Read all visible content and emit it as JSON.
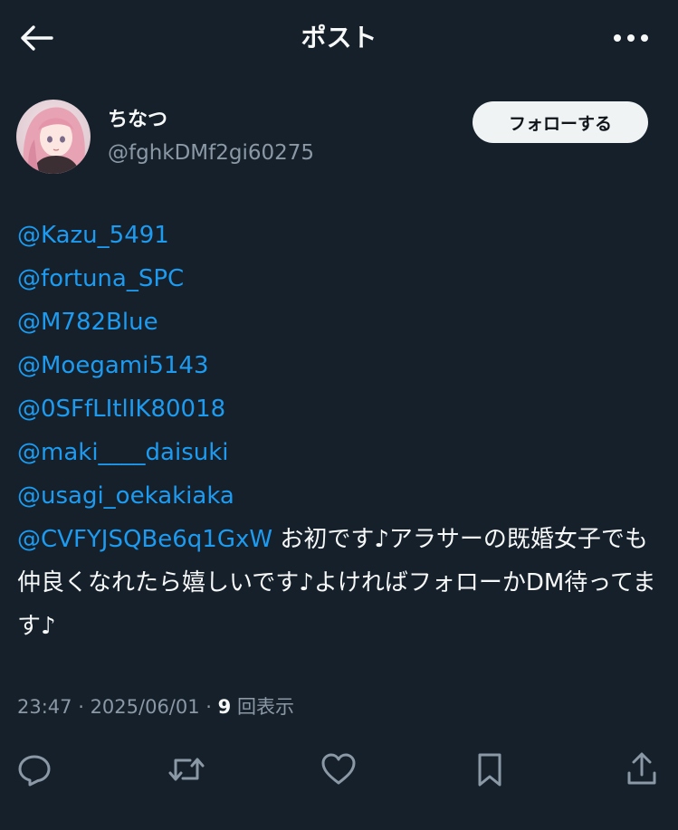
{
  "header": {
    "title": "ポスト",
    "back_icon": "arrow-left-icon",
    "more_icon": "more-horizontal-icon"
  },
  "author": {
    "display_name": "ちなつ",
    "handle": "@fghkDMf2gi60275",
    "follow_label": "フォローする"
  },
  "post": {
    "mentions": [
      "@Kazu_5491",
      "@fortuna_SPC",
      "@M782Blue",
      "@Moegami5143",
      "@0SFfLItlIK80018",
      "@maki____daisuki",
      "@usagi_oekakiaka",
      "@CVFYJSQBe6q1GxW"
    ],
    "text": " お初です♪アラサーの既婚女子でも仲良くなれたら嬉しいです♪よければフォローかDM待ってます♪"
  },
  "meta": {
    "time": "23:47",
    "separator1": " · ",
    "date": "2025/06/01",
    "separator2": " · ",
    "views_count": "9",
    "views_label": " 回表示"
  },
  "actions": [
    {
      "icon": "reply-icon"
    },
    {
      "icon": "repost-icon"
    },
    {
      "icon": "like-icon"
    },
    {
      "icon": "bookmark-icon"
    },
    {
      "icon": "share-icon"
    }
  ],
  "colors": {
    "background": "#15202b",
    "mention": "#1d9bf0",
    "secondary_text": "#8b98a5",
    "primary_text": "#f7f9f9",
    "follow_button_bg": "#eff3f4"
  }
}
